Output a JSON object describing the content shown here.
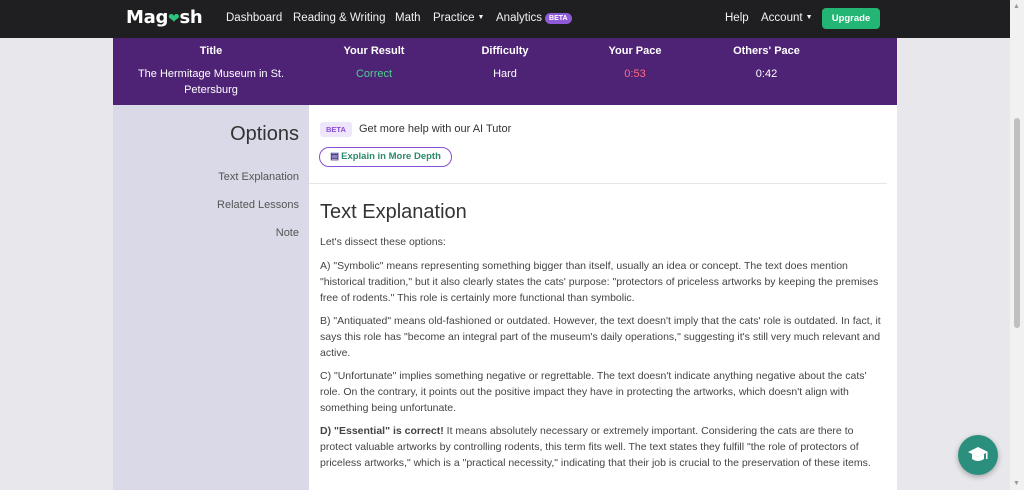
{
  "nav": {
    "logo_pre": "Mag",
    "logo_post": "sh",
    "items": [
      "Dashboard",
      "Reading & Writing",
      "Math",
      "Practice",
      "Analytics"
    ],
    "analytics_badge": "BETA",
    "help": "Help",
    "account": "Account",
    "upgrade": "Upgrade"
  },
  "result": {
    "headers": [
      "Title",
      "Your Result",
      "Difficulty",
      "Your Pace",
      "Others' Pace"
    ],
    "title": "The Hermitage Museum in St. Petersburg",
    "your_result": "Correct",
    "difficulty": "Hard",
    "your_pace": "0:53",
    "others_pace": "0:42"
  },
  "options": {
    "heading": "Options",
    "items": [
      "Text Explanation",
      "Related Lessons",
      "Note"
    ]
  },
  "tutor": {
    "badge": "BETA",
    "prompt": "Get more help with our AI Tutor",
    "button": "Explain in More Depth"
  },
  "explanation": {
    "heading": "Text Explanation",
    "intro": "Let's dissect these options:",
    "a": "A) \"Symbolic\" means representing something bigger than itself, usually an idea or concept. The text does mention \"historical tradition,\" but it also clearly states the cats' purpose: \"protectors of priceless artworks by keeping the premises free of rodents.\" This role is certainly more functional than symbolic.",
    "b": "B) \"Antiquated\" means old-fashioned or outdated. However, the text doesn't imply that the cats' role is outdated. In fact, it says this role has \"become an integral part of the museum's daily operations,\" suggesting it's still very much relevant and active.",
    "c": "C) \"Unfortunate\" implies something negative or regrettable. The text doesn't indicate anything negative about the cats' role. On the contrary, it points out the positive impact they have in protecting the artworks, which doesn't align with something being unfortunate.",
    "d_bold": "D) \"Essential\" is correct!",
    "d_rest": " It means absolutely necessary or extremely important. Considering the cats are there to protect valuable artworks by controlling rodents, this term fits well. The text states they fulfill \"the role of protectors of priceless artworks,\" which is a \"practical necessity,\" indicating that their job is crucial to the preservation of these items."
  },
  "colors": {
    "banner": "#4e2275",
    "correct": "#4fd08e",
    "pace": "#ff6b7c",
    "upgrade": "#22b573",
    "accent": "#8a4fd6"
  },
  "icons": [
    "heart-check-icon",
    "caret-down-icon",
    "document-icon",
    "graduation-cap-icon"
  ]
}
